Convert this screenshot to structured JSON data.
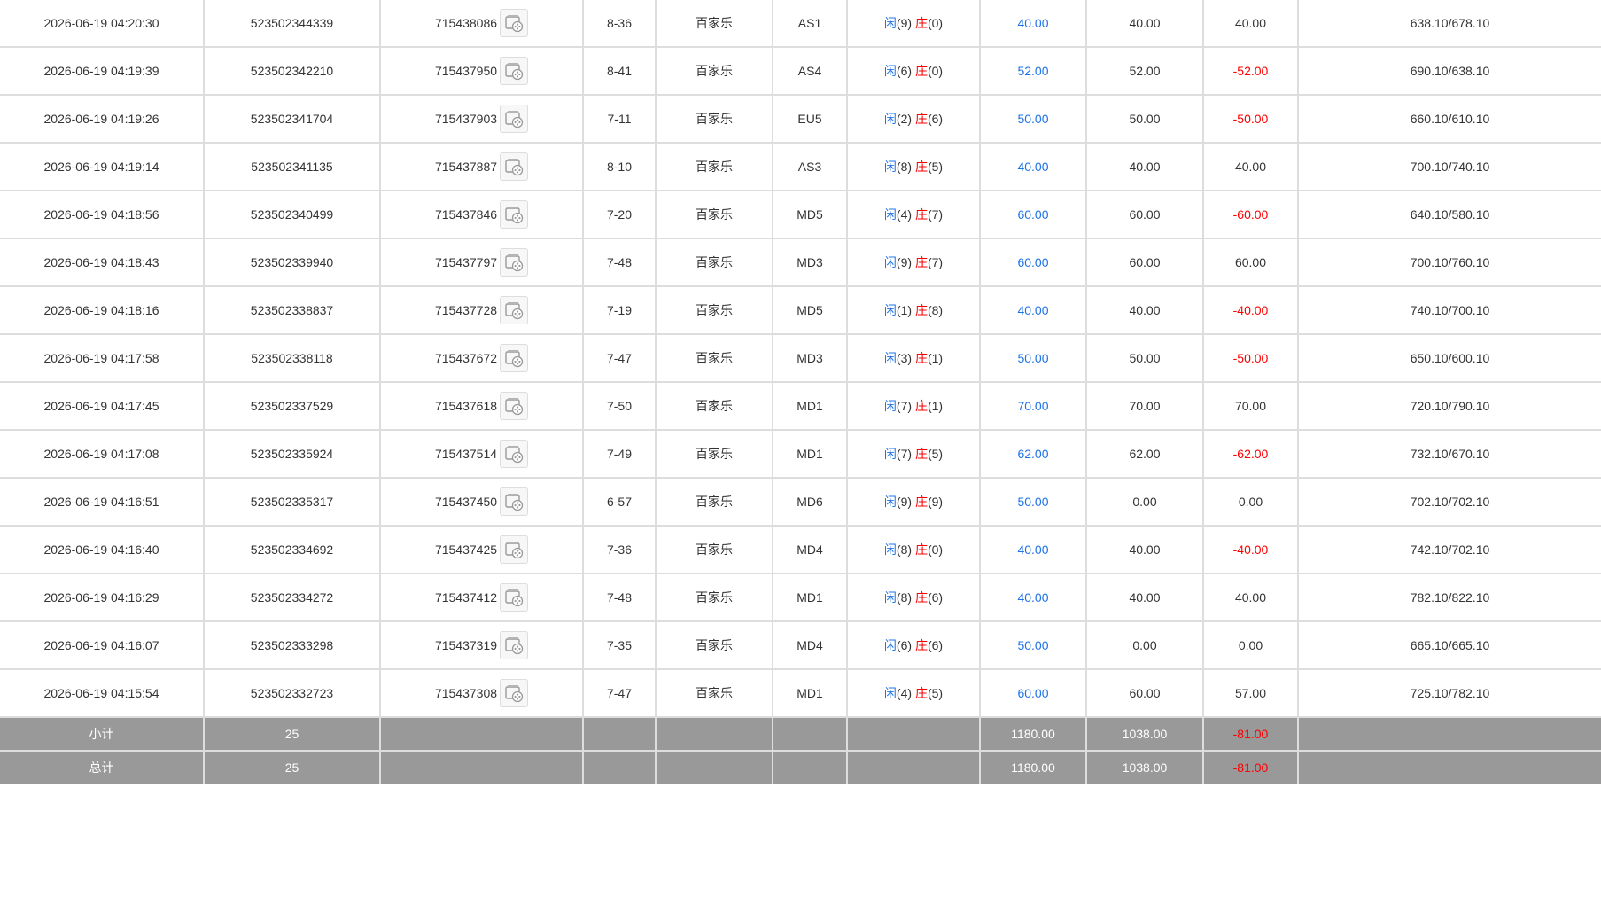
{
  "labels": {
    "player": "闲",
    "banker": "庄"
  },
  "colors": {
    "blue_text": "#1e73e8",
    "red_text": "#ff0000",
    "summary_bg": "#999999",
    "grid": "#dddddd"
  },
  "icons": {
    "replay": "video-replay-icon"
  },
  "rows": [
    {
      "time": "2026-06-19 04:20:30",
      "bet_id": "523502344339",
      "game_id": "715438086",
      "shoe": "8-36",
      "game": "百家乐",
      "table": "AS1",
      "player_pts": "(9)",
      "banker_pts": "(0)",
      "bet": "40.00",
      "valid": "40.00",
      "win": "40.00",
      "win_negative": false,
      "balance": "638.10/678.10"
    },
    {
      "time": "2026-06-19 04:19:39",
      "bet_id": "523502342210",
      "game_id": "715437950",
      "shoe": "8-41",
      "game": "百家乐",
      "table": "AS4",
      "player_pts": "(6)",
      "banker_pts": "(0)",
      "bet": "52.00",
      "valid": "52.00",
      "win": "-52.00",
      "win_negative": true,
      "balance": "690.10/638.10"
    },
    {
      "time": "2026-06-19 04:19:26",
      "bet_id": "523502341704",
      "game_id": "715437903",
      "shoe": "7-11",
      "game": "百家乐",
      "table": "EU5",
      "player_pts": "(2)",
      "banker_pts": "(6)",
      "bet": "50.00",
      "valid": "50.00",
      "win": "-50.00",
      "win_negative": true,
      "balance": "660.10/610.10"
    },
    {
      "time": "2026-06-19 04:19:14",
      "bet_id": "523502341135",
      "game_id": "715437887",
      "shoe": "8-10",
      "game": "百家乐",
      "table": "AS3",
      "player_pts": "(8)",
      "banker_pts": "(5)",
      "bet": "40.00",
      "valid": "40.00",
      "win": "40.00",
      "win_negative": false,
      "balance": "700.10/740.10"
    },
    {
      "time": "2026-06-19 04:18:56",
      "bet_id": "523502340499",
      "game_id": "715437846",
      "shoe": "7-20",
      "game": "百家乐",
      "table": "MD5",
      "player_pts": "(4)",
      "banker_pts": "(7)",
      "bet": "60.00",
      "valid": "60.00",
      "win": "-60.00",
      "win_negative": true,
      "balance": "640.10/580.10"
    },
    {
      "time": "2026-06-19 04:18:43",
      "bet_id": "523502339940",
      "game_id": "715437797",
      "shoe": "7-48",
      "game": "百家乐",
      "table": "MD3",
      "player_pts": "(9)",
      "banker_pts": "(7)",
      "bet": "60.00",
      "valid": "60.00",
      "win": "60.00",
      "win_negative": false,
      "balance": "700.10/760.10"
    },
    {
      "time": "2026-06-19 04:18:16",
      "bet_id": "523502338837",
      "game_id": "715437728",
      "shoe": "7-19",
      "game": "百家乐",
      "table": "MD5",
      "player_pts": "(1)",
      "banker_pts": "(8)",
      "bet": "40.00",
      "valid": "40.00",
      "win": "-40.00",
      "win_negative": true,
      "balance": "740.10/700.10"
    },
    {
      "time": "2026-06-19 04:17:58",
      "bet_id": "523502338118",
      "game_id": "715437672",
      "shoe": "7-47",
      "game": "百家乐",
      "table": "MD3",
      "player_pts": "(3)",
      "banker_pts": "(1)",
      "bet": "50.00",
      "valid": "50.00",
      "win": "-50.00",
      "win_negative": true,
      "balance": "650.10/600.10"
    },
    {
      "time": "2026-06-19 04:17:45",
      "bet_id": "523502337529",
      "game_id": "715437618",
      "shoe": "7-50",
      "game": "百家乐",
      "table": "MD1",
      "player_pts": "(7)",
      "banker_pts": "(1)",
      "bet": "70.00",
      "valid": "70.00",
      "win": "70.00",
      "win_negative": false,
      "balance": "720.10/790.10"
    },
    {
      "time": "2026-06-19 04:17:08",
      "bet_id": "523502335924",
      "game_id": "715437514",
      "shoe": "7-49",
      "game": "百家乐",
      "table": "MD1",
      "player_pts": "(7)",
      "banker_pts": "(5)",
      "bet": "62.00",
      "valid": "62.00",
      "win": "-62.00",
      "win_negative": true,
      "balance": "732.10/670.10"
    },
    {
      "time": "2026-06-19 04:16:51",
      "bet_id": "523502335317",
      "game_id": "715437450",
      "shoe": "6-57",
      "game": "百家乐",
      "table": "MD6",
      "player_pts": "(9)",
      "banker_pts": "(9)",
      "bet": "50.00",
      "valid": "0.00",
      "win": "0.00",
      "win_negative": false,
      "balance": "702.10/702.10"
    },
    {
      "time": "2026-06-19 04:16:40",
      "bet_id": "523502334692",
      "game_id": "715437425",
      "shoe": "7-36",
      "game": "百家乐",
      "table": "MD4",
      "player_pts": "(8)",
      "banker_pts": "(0)",
      "bet": "40.00",
      "valid": "40.00",
      "win": "-40.00",
      "win_negative": true,
      "balance": "742.10/702.10"
    },
    {
      "time": "2026-06-19 04:16:29",
      "bet_id": "523502334272",
      "game_id": "715437412",
      "shoe": "7-48",
      "game": "百家乐",
      "table": "MD1",
      "player_pts": "(8)",
      "banker_pts": "(6)",
      "bet": "40.00",
      "valid": "40.00",
      "win": "40.00",
      "win_negative": false,
      "balance": "782.10/822.10"
    },
    {
      "time": "2026-06-19 04:16:07",
      "bet_id": "523502333298",
      "game_id": "715437319",
      "shoe": "7-35",
      "game": "百家乐",
      "table": "MD4",
      "player_pts": "(6)",
      "banker_pts": "(6)",
      "bet": "50.00",
      "valid": "0.00",
      "win": "0.00",
      "win_negative": false,
      "balance": "665.10/665.10"
    },
    {
      "time": "2026-06-19 04:15:54",
      "bet_id": "523502332723",
      "game_id": "715437308",
      "shoe": "7-47",
      "game": "百家乐",
      "table": "MD1",
      "player_pts": "(4)",
      "banker_pts": "(5)",
      "bet": "60.00",
      "valid": "60.00",
      "win": "57.00",
      "win_negative": false,
      "balance": "725.10/782.10"
    }
  ],
  "summary": [
    {
      "label": "小计",
      "count": "25",
      "bet": "1180.00",
      "valid": "1038.00",
      "win": "-81.00"
    },
    {
      "label": "总计",
      "count": "25",
      "bet": "1180.00",
      "valid": "1038.00",
      "win": "-81.00"
    }
  ]
}
